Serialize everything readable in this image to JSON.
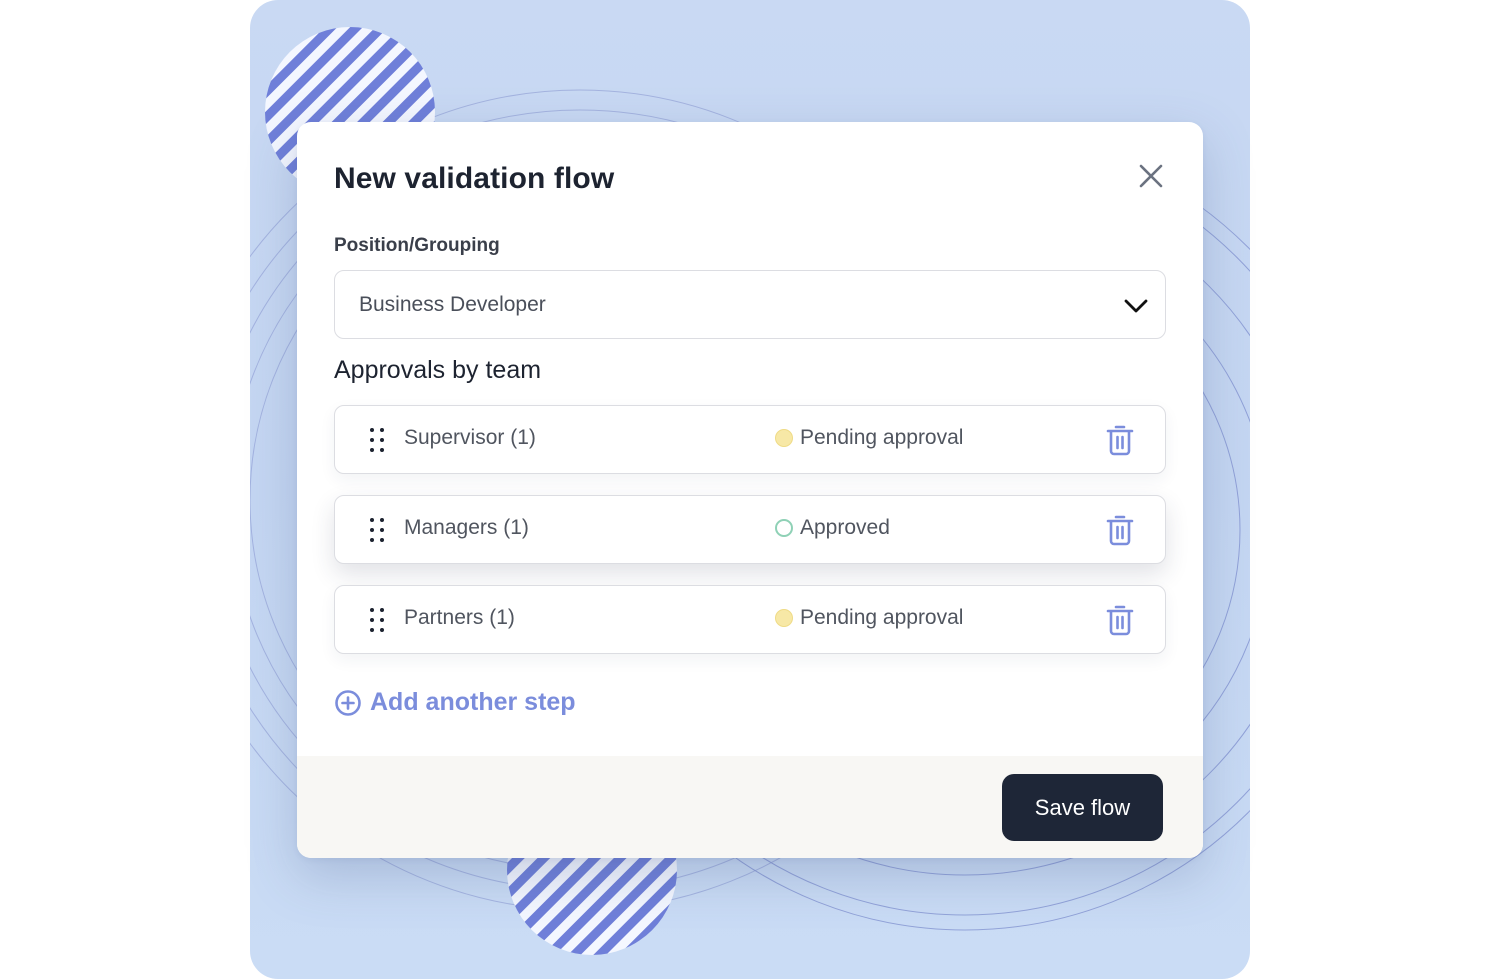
{
  "modal": {
    "title": "New validation flow",
    "close_icon": "close-icon"
  },
  "position_field": {
    "label": "Position/Grouping",
    "selected_value": "Business Developer",
    "icon": "chevron-down-icon"
  },
  "approvals": {
    "section_title": "Approvals by team",
    "steps": [
      {
        "name": "Supervisor (1)",
        "status": "Pending approval",
        "status_type": "pending"
      },
      {
        "name": "Managers (1)",
        "status": "Approved",
        "status_type": "approved"
      },
      {
        "name": "Partners (1)",
        "status": "Pending approval",
        "status_type": "pending"
      }
    ],
    "add_step_label": "Add another step"
  },
  "footer": {
    "save_label": "Save flow"
  },
  "colors": {
    "accent": "#7b8ddc",
    "primary_button": "#1e2637",
    "pending": "#f7e8a6",
    "approved": "#8fd1b6",
    "background": "#c9d9f3"
  }
}
